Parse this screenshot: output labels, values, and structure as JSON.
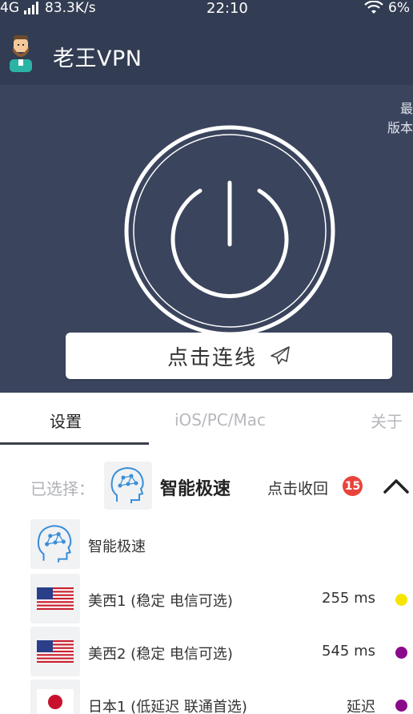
{
  "status_bar": {
    "network": "4G",
    "speed": "83.3K/s",
    "time": "22:10",
    "battery": "6%",
    "icons": [
      "signal-icon",
      "wifi-icon"
    ]
  },
  "app_bar": {
    "title": "老王VPN",
    "avatar_icon": "bearded-man-avatar"
  },
  "hero": {
    "version_note_line1": "最",
    "version_note_line2": "版本",
    "power_icon": "power-icon",
    "connect_label": "点击连线",
    "connect_icon": "paper-plane-icon"
  },
  "tabs": [
    {
      "label": "设置",
      "active": true
    },
    {
      "label": "iOS/PC/Mac",
      "active": false
    },
    {
      "label": "关于",
      "active": false
    }
  ],
  "selection": {
    "label": "已选择：",
    "name": "智能极速",
    "collapse_label": "点击收回",
    "badge": "15",
    "icon": "brain-head-icon"
  },
  "servers": [
    {
      "name": "智能极速",
      "latency": "",
      "icon": "brain-head-icon",
      "dot_color": ""
    },
    {
      "name": "美西1 (稳定 电信可选)",
      "latency": "255 ms",
      "icon": "us-flag-icon",
      "dot_color": "#f5e400"
    },
    {
      "name": "美西2 (稳定 电信可选)",
      "latency": "545 ms",
      "icon": "us-flag-icon",
      "dot_color": "#8a0a8c"
    },
    {
      "name": "日本1 (低延迟 联通首选)",
      "latency": "延迟",
      "icon": "jp-flag-icon",
      "dot_color": "#8a0a8c"
    }
  ],
  "colors": {
    "header_bg": "#323c52",
    "hero_bg": "#3a445d",
    "badge": "#e8433c"
  }
}
